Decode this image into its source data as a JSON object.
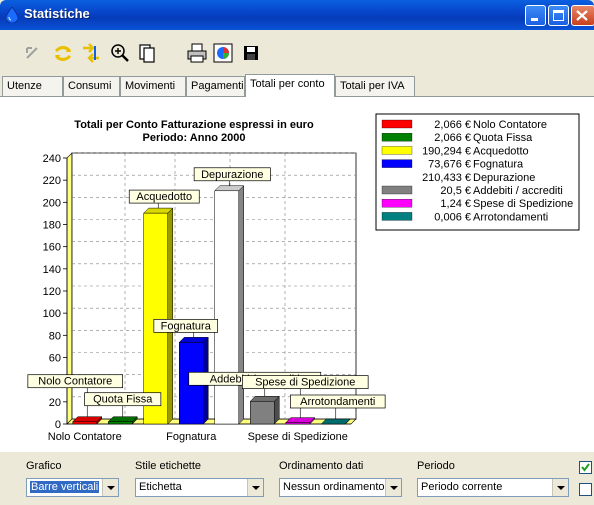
{
  "window": {
    "title": "Statistiche"
  },
  "toolbar": {
    "icons": [
      "cursor-arrow-icon",
      "refresh-icon",
      "sort-icon",
      "zoom-icon",
      "copy-icon",
      "print-icon",
      "chart-wizard-icon",
      "save-icon"
    ]
  },
  "tabs": [
    "Utenze",
    "Consumi",
    "Movimenti",
    "Pagamenti",
    "Totali per conto",
    "Totali per IVA"
  ],
  "active_tab": 4,
  "chart_data": {
    "type": "bar",
    "title": "Totali per Conto Fatturazione espressi in euro",
    "subtitle": "Periodo: Anno 2000",
    "categories": [
      "Nolo Contatore",
      "Quota Fissa",
      "Acquedotto",
      "Fognatura",
      "Depurazione",
      "Addebiti / accrediti",
      "Spese di Spedizione",
      "Arrotondamenti"
    ],
    "values": [
      2.066,
      2.066,
      190.294,
      73.676,
      210.433,
      20.5,
      1.24,
      0.006
    ],
    "colors": [
      "#ff0000",
      "#008000",
      "#ffff00",
      "#0000ff",
      "#ffffff",
      "#808080",
      "#ff00ff",
      "#008080"
    ],
    "xtick_labels": [
      "Nolo Contatore",
      "Fognatura",
      "Spese di Spedizione"
    ],
    "ylim": [
      0,
      240
    ],
    "yticks": [
      0,
      20,
      40,
      60,
      80,
      100,
      120,
      140,
      160,
      180,
      200,
      220,
      240
    ],
    "grid": true,
    "legend_position": "top-right",
    "legend": [
      {
        "value": "2,066 €",
        "name": "Nolo Contatore"
      },
      {
        "value": "2,066 €",
        "name": "Quota Fissa"
      },
      {
        "value": "190,294 €",
        "name": "Acquedotto"
      },
      {
        "value": "73,676 €",
        "name": "Fognatura"
      },
      {
        "value": "210,433 €",
        "name": "Depurazione"
      },
      {
        "value": "20,5 €",
        "name": "Addebiti / accrediti"
      },
      {
        "value": "1,24 €",
        "name": "Spese di Spedizione"
      },
      {
        "value": "0,006 €",
        "name": "Arrotondamenti"
      }
    ]
  },
  "controls": {
    "grafico": {
      "label": "Grafico",
      "value": "Barre verticali"
    },
    "stile": {
      "label": "Stile etichette",
      "value": "Etichetta"
    },
    "ordinamento": {
      "label": "Ordinamento dati",
      "value": "Nessun ordinamento"
    },
    "periodo": {
      "label": "Periodo",
      "value": "Periodo corrente"
    },
    "checkbox_top_checked": true,
    "checkbox_bottom_checked": false
  }
}
